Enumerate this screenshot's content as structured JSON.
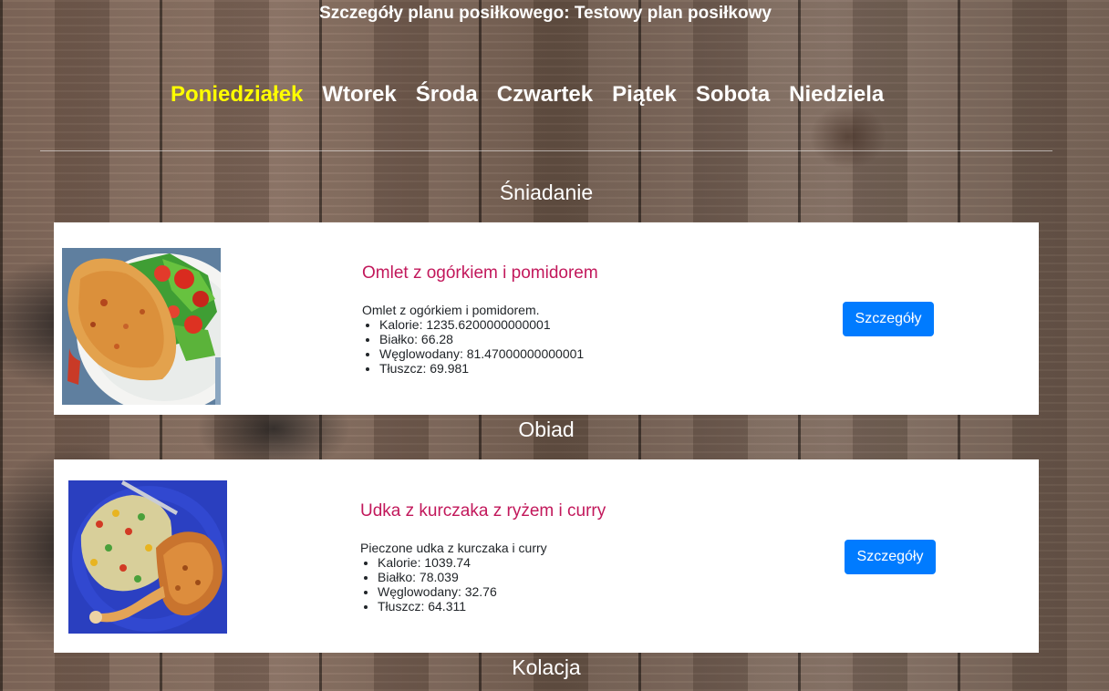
{
  "page": {
    "title": "Szczegóły planu posiłkowego: Testowy plan posiłkowy"
  },
  "days": [
    {
      "label": "Poniedziałek",
      "active": true
    },
    {
      "label": "Wtorek"
    },
    {
      "label": "Środa"
    },
    {
      "label": "Czwartek"
    },
    {
      "label": "Piątek"
    },
    {
      "label": "Sobota"
    },
    {
      "label": "Niedziela"
    }
  ],
  "sections": {
    "breakfast": {
      "heading": "Śniadanie",
      "meal": {
        "name": "Omlet z ogórkiem i pomidorem",
        "description": "Omlet z ogórkiem i pomidorem.",
        "nutrients": [
          "Kalorie: 1235.6200000000001",
          "Białko: 66.28",
          "Węglowodany: 81.47000000000001",
          "Tłuszcz: 69.981"
        ],
        "button_label": "Szczegóły"
      }
    },
    "lunch": {
      "heading": "Obiad",
      "meal": {
        "name": "Udka z kurczaka z ryżem i curry",
        "description": "Pieczone udka z kurczaka i curry",
        "nutrients": [
          "Kalorie: 1039.74",
          "Białko: 78.039",
          "Węglowodany: 32.76",
          "Tłuszcz: 64.311"
        ],
        "button_label": "Szczegóły"
      }
    },
    "dinner": {
      "heading": "Kolacja"
    }
  },
  "colors": {
    "active_day": "#ffff00",
    "meal_title": "#c2185b",
    "button": "#007bff"
  }
}
